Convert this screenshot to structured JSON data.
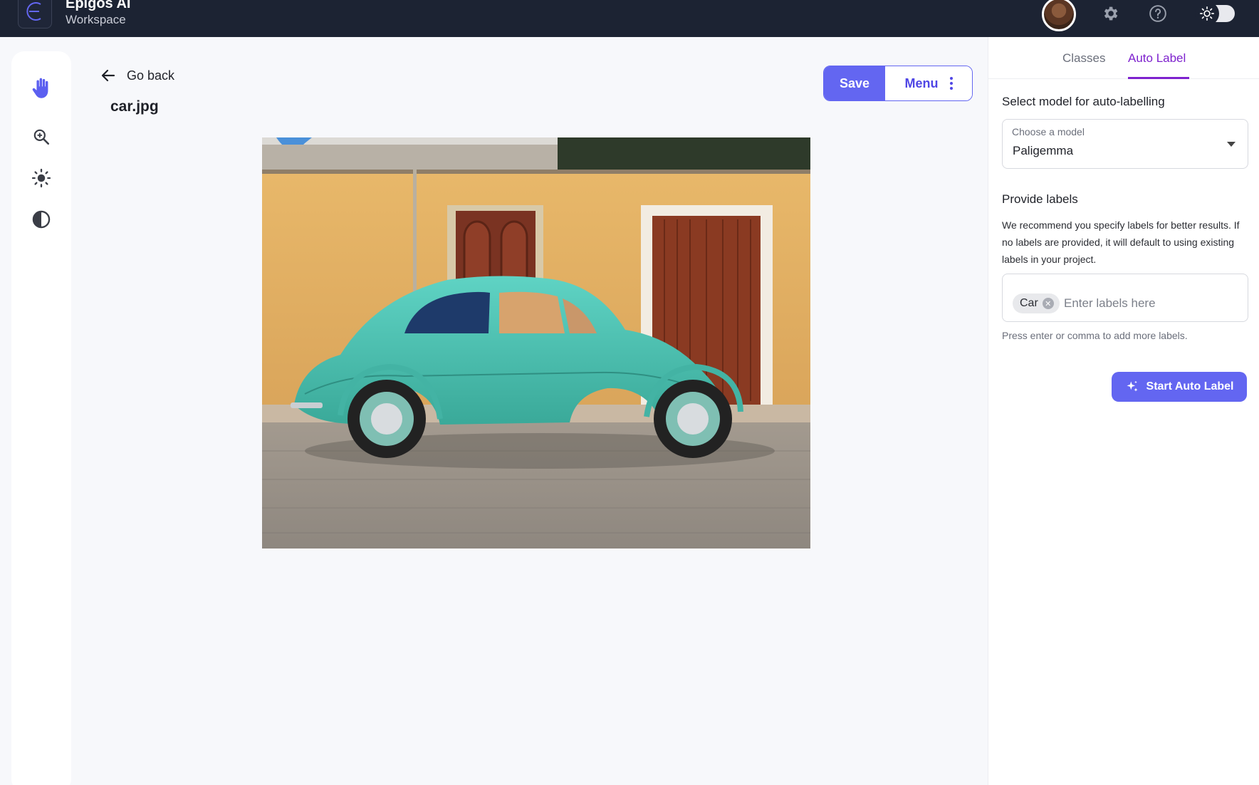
{
  "app": {
    "brand_title": "Epigos AI",
    "brand_subtitle": "Workspace"
  },
  "header": {
    "icons": [
      "user-avatar",
      "gear-icon",
      "help-icon",
      "sun-icon"
    ],
    "theme_mode": "light"
  },
  "toolbar": {
    "tools": [
      "hand-icon",
      "zoom-in-icon",
      "brightness-icon",
      "contrast-icon"
    ],
    "active_tool": "hand-icon"
  },
  "main": {
    "go_back_label": "Go back",
    "file_name": "car.jpg",
    "save_label": "Save",
    "menu_label": "Menu"
  },
  "panel": {
    "tabs": [
      {
        "label": "Classes",
        "active": false
      },
      {
        "label": "Auto Label",
        "active": true
      }
    ],
    "model_section_title": "Select model for auto-labelling",
    "model_select": {
      "caption": "Choose a model",
      "value": "Paligemma"
    },
    "labels_section_title": "Provide labels",
    "labels_description": "We recommend you specify labels for better results. If no labels are provided, it will default to using existing labels in your project.",
    "labels": [
      "Car"
    ],
    "labels_placeholder": "Enter labels here",
    "labels_hint": "Press enter or comma to add more labels.",
    "start_button_label": "Start Auto Label"
  },
  "colors": {
    "header_bg": "#1c2333",
    "accent": "#6366f1",
    "tab_active": "#7e22ce"
  }
}
